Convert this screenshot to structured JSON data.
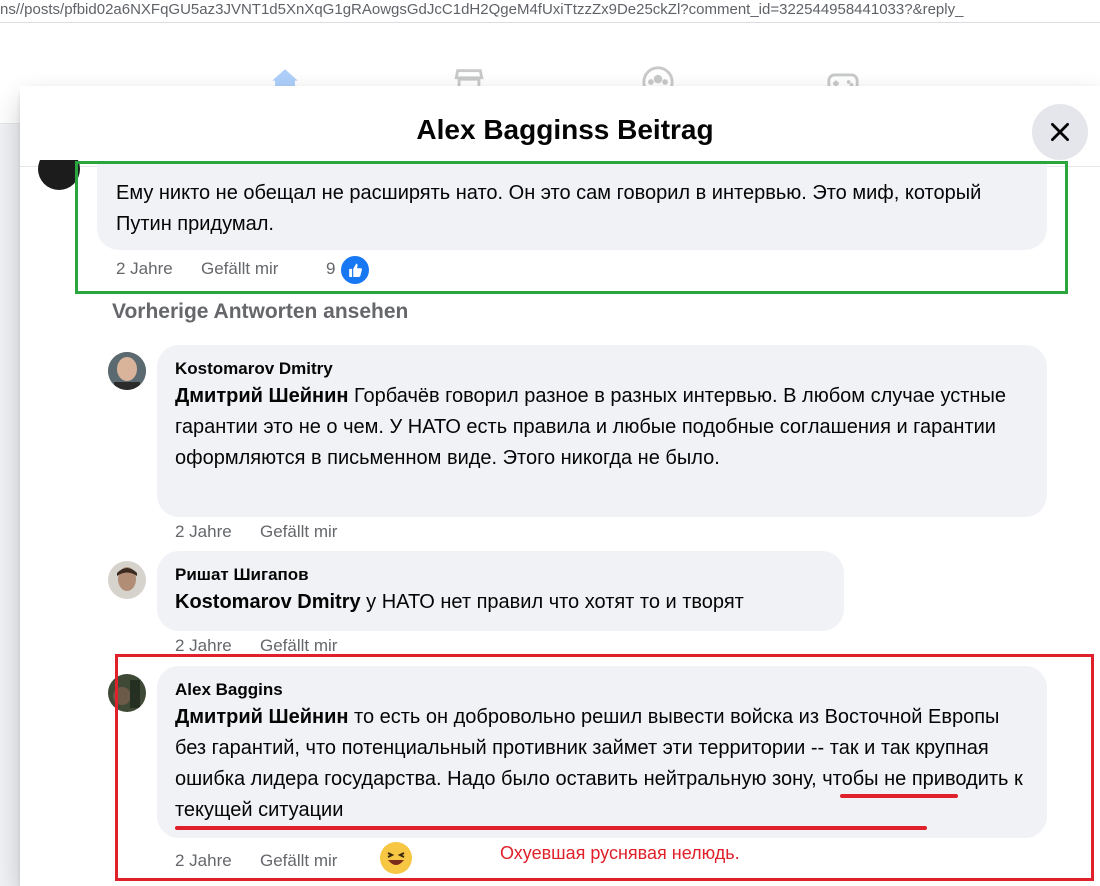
{
  "browser": {
    "url": "ns//posts/pfbid02a6NXFqGU5az3JVNT1d5XnXqG1gRAowgsGdJcC1dH2QgeM4fUxiTtzzZx9De25ckZl?comment_id=322544958441033?&reply_"
  },
  "nav": {
    "icons": [
      "home-icon",
      "marketplace-icon",
      "groups-icon",
      "gaming-icon"
    ]
  },
  "modal": {
    "title": "Alex Bagginss Beitrag",
    "close_icon": "close-icon"
  },
  "comments": [
    {
      "text": "Ему никто не обещал не расширять нато. Он это сам говорил в интервью. Это миф, который Путин придумал.",
      "time": "2 Jahre",
      "like_label": "Gefällt mir",
      "reaction_count": "9",
      "reaction_icon": "thumbs-up-icon"
    }
  ],
  "previous_replies_label": "Vorherige Antworten ansehen",
  "replies": [
    {
      "author": "Kostomarov Dmitry",
      "mention": "Дмитрий Шейнин",
      "text": " Горбачёв говорил разное в разных интервью. В любом случае устные гарантии это не о чем. У НАТО есть правила и любые подобные соглашения и гарантии оформляются в письменном виде. Этого никогда не было.",
      "time": "2 Jahre",
      "like_label": "Gefällt mir"
    },
    {
      "author": "Ришат Шигапов",
      "mention": "Kostomarov Dmitry",
      "text": " у НАТО нет правил что хотят то и творят",
      "time": "2 Jahre",
      "like_label": "Gefällt mir"
    },
    {
      "author": "Alex Baggins",
      "mention": "Дмитрий Шейнин",
      "text": " то есть он добровольно решил вывести войска из Восточной Европы без гарантий, что потенциальный противник займет эти территории -- так и так крупная ошибка лидера государства. Надо было оставить нейтральную зону, чтобы не приводить к текущей ситуации",
      "time": "2 Jahre",
      "like_label": "Gefällt mir",
      "reaction_icon": "laughing-emoji-icon"
    }
  ],
  "annotation": {
    "text": "Охуевшая руснявая нелюдь.",
    "color": "#e0202a",
    "highlight_green": "#2aa63f"
  }
}
